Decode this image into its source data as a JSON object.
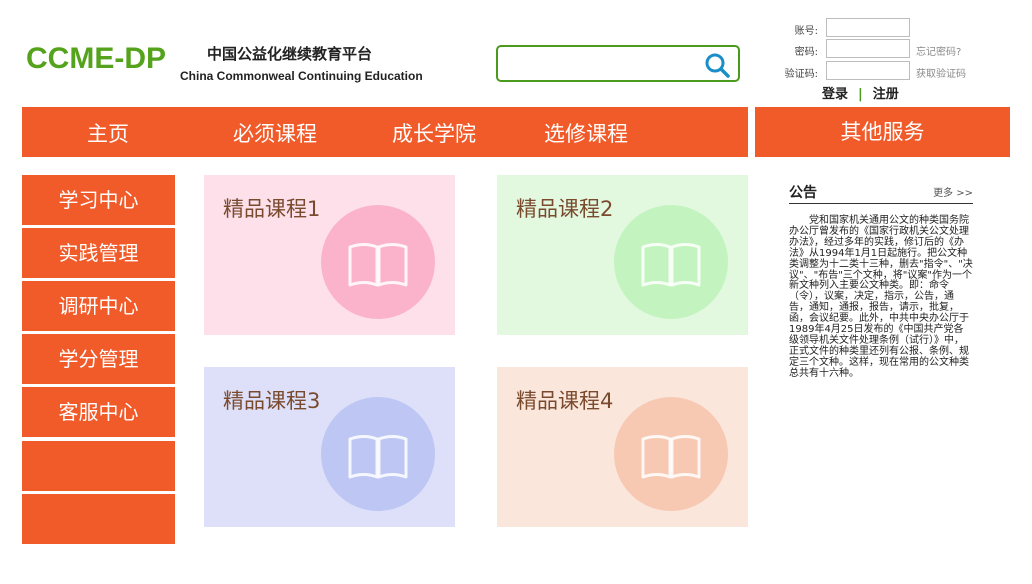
{
  "header": {
    "logo": "CCME-DP",
    "title_cn": "中国公益化继续教育平台",
    "title_en": "China Commonweal Continuing Education"
  },
  "search": {
    "placeholder": "",
    "value": ""
  },
  "login": {
    "account_label": "账号:",
    "password_label": "密码:",
    "captcha_label": "验证码:",
    "forgot_link": "忘记密码?",
    "captcha_link": "获取验证码",
    "login_button": "登录",
    "separator": "|",
    "register_button": "注册"
  },
  "nav": {
    "items": [
      {
        "label": "主页"
      },
      {
        "label": "必须课程"
      },
      {
        "label": "成长学院"
      },
      {
        "label": "选修课程"
      }
    ],
    "other": "其他服务"
  },
  "sidebar": {
    "items": [
      {
        "label": "学习中心"
      },
      {
        "label": "实践管理"
      },
      {
        "label": "调研中心"
      },
      {
        "label": "学分管理"
      },
      {
        "label": "客服中心"
      },
      {
        "label": ""
      },
      {
        "label": ""
      }
    ]
  },
  "courses": [
    {
      "title": "精品课程1",
      "bg": "#fde0ea",
      "circle": "#fbb3cc",
      "icon": "open-book-icon"
    },
    {
      "title": "精品课程2",
      "bg": "#e2f9e0",
      "circle": "#c3f4bf",
      "icon": "open-book-icon"
    },
    {
      "title": "精品课程3",
      "bg": "#dde0f8",
      "circle": "#bec6f3",
      "icon": "open-book-icon"
    },
    {
      "title": "精品课程4",
      "bg": "#fbe6dc",
      "circle": "#f7c9b3",
      "icon": "open-book-icon"
    }
  ],
  "notice": {
    "title": "公告",
    "more": "更多 >>",
    "body": "党和国家机关通用公文的种类国务院办公厅曾发布的《国家行政机关公文处理办法》，经过多年的实践，修订后的《办法》从1994年1月1日起施行。把公文种类调整为十二类十三种，删去\"指令\"、\"决议\"、\"布告\"三个文种，将\"议案\"作为一个新文种列入主要公文种类。即：命令（令），议案，决定，指示，公告，通告，通知，通报，报告，请示，批复，函，会议纪要。此外，中共中央办公厅于1989年4月25日发布的《中国共产党各级领导机关文件处理条例（试行）》中，正式文件的种类里还列有公报、条例、规定三个文种。这样，现在常用的公文种类总共有十六种。"
  },
  "colors": {
    "accent": "#f15a29",
    "brand_green": "#55a31d"
  }
}
